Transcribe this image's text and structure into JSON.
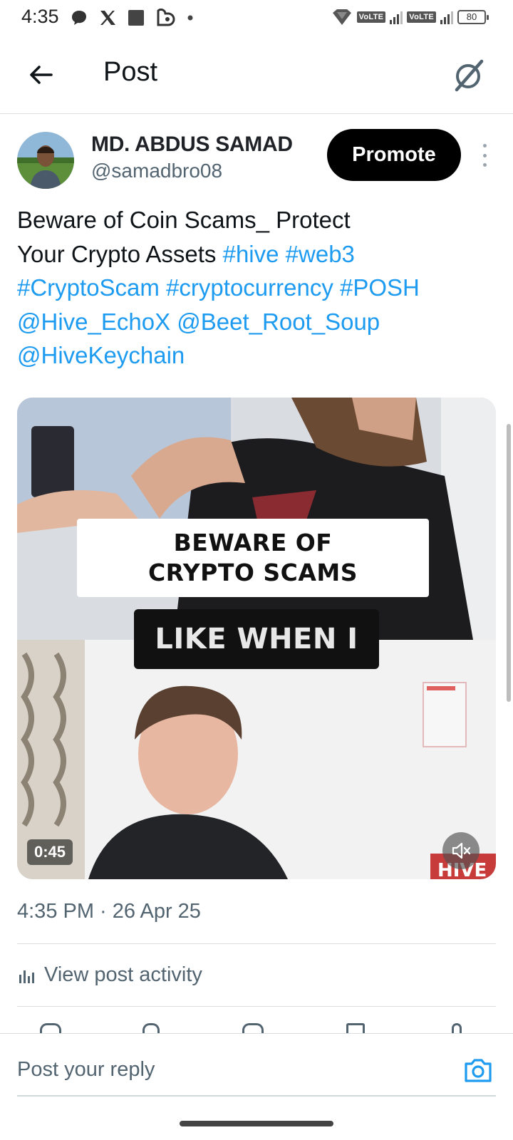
{
  "status_bar": {
    "time": "4:35",
    "volte1": "VoLTE",
    "volte2": "VoLTE",
    "battery": "80",
    "icons": [
      "chat-bubble-icon",
      "x-logo-icon",
      "gallery-icon",
      "cloud-sync-icon",
      "dot-icon",
      "wifi-hotspot-icon",
      "signal-icon",
      "battery-icon"
    ]
  },
  "header": {
    "title": "Post",
    "back_icon": "arrow-left-icon",
    "grok_icon": "grok-icon"
  },
  "post": {
    "author_name": "MD. ABDUS SAMAD",
    "author_handle": "@samadbro08",
    "promote_label": "Promote",
    "text_plain_1": "Beware of Coin Scams_ Protect",
    "text_plain_2": "Your Crypto Assets ",
    "tags": [
      "#hive",
      "#web3",
      "#CryptoScam",
      "#cryptocurrency",
      "#POSH"
    ],
    "mentions": [
      "@Hive_EchoX",
      "@Beet_Root_Soup",
      "@HiveKeychain"
    ],
    "media": {
      "caption_line1": "BEWARE OF",
      "caption_line2": "CRYPTO SCAMS",
      "caption_sub": "LIKE WHEN I",
      "watermark": "HIVE",
      "duration": "0:45"
    },
    "timestamp": "4:35 PM · 26 Apr 25",
    "activity_label": "View post activity"
  },
  "reply": {
    "placeholder": "Post your reply"
  },
  "colors": {
    "link": "#1d9bf0",
    "secondary_text": "#536471",
    "primary_text": "#0f1419",
    "promote_bg": "#000000"
  }
}
